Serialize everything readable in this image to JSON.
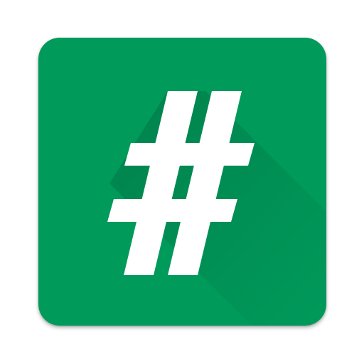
{
  "app_icon": {
    "glyph": "hash-symbol",
    "colors": {
      "background": "#009A5B",
      "long_shadow": "#008A4F",
      "glyph": "#FFFFFF"
    }
  }
}
